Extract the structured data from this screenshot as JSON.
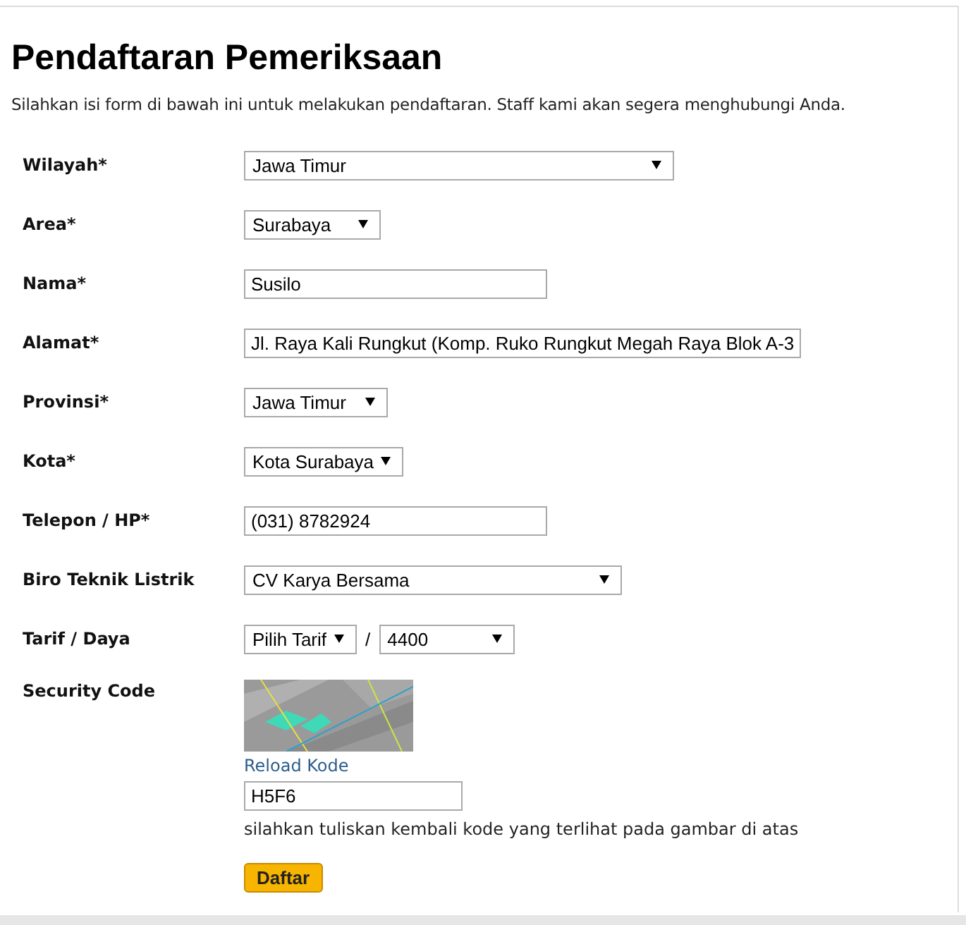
{
  "title": "Pendaftaran Pemeriksaan",
  "intro": "Silahkan isi form di bawah ini untuk melakukan pendaftaran. Staff kami akan segera menghubungi Anda.",
  "fields": [
    {
      "label": "Wilayah*",
      "kind": "select",
      "value": "Jawa Timur"
    },
    {
      "label": "Area*",
      "kind": "select",
      "value": "Surabaya"
    },
    {
      "label": "Nama*",
      "kind": "input",
      "value": "Susilo"
    },
    {
      "label": "Alamat*",
      "kind": "input",
      "value": "Jl. Raya Kali Rungkut (Komp. Ruko Rungkut Megah Raya Blok A-3"
    },
    {
      "label": "Provinsi*",
      "kind": "select",
      "value": "Jawa Timur"
    },
    {
      "label": "Kota*",
      "kind": "select",
      "value": "Kota Surabaya"
    },
    {
      "label": "Telepon / HP*",
      "kind": "input",
      "value": "(031) 8782924"
    },
    {
      "label": "Biro Teknik Listrik",
      "kind": "select",
      "value": "CV Karya Bersama"
    },
    {
      "label": "Tarif / Daya",
      "kind": "pair",
      "value": "Pilih Tarif",
      "separator": "/",
      "value2": "4400"
    }
  ],
  "security": {
    "label": "Security Code",
    "reload_link": "Reload Kode",
    "value": "H5F6",
    "hint": "silahkan tuliskan kembali kode yang terlihat pada gambar di atas"
  },
  "submit": "Daftar"
}
